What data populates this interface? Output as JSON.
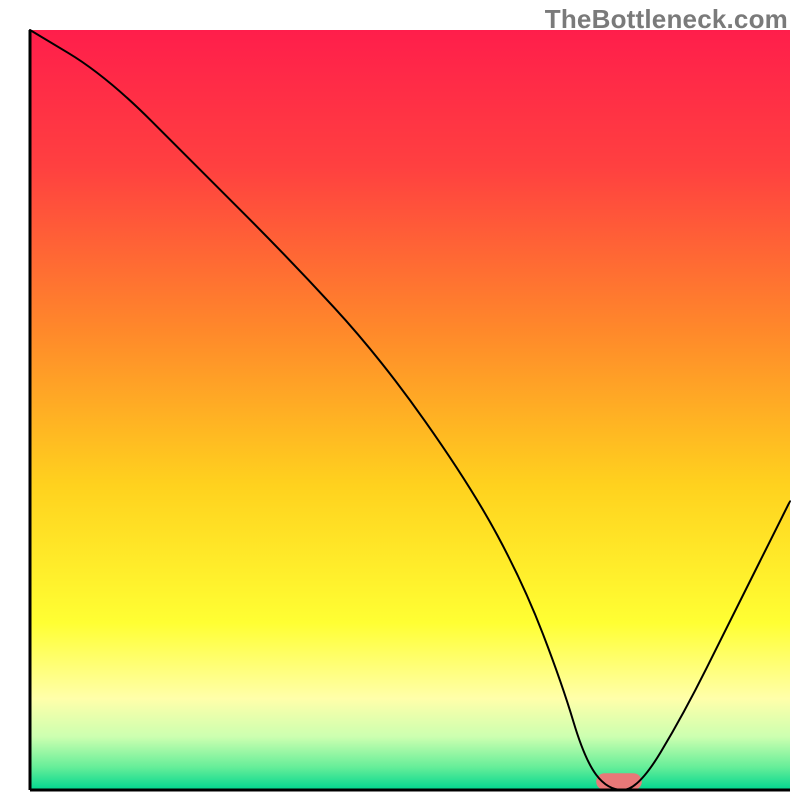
{
  "watermark": "TheBottleneck.com",
  "chart_data": {
    "type": "line",
    "title": "",
    "xlabel": "",
    "ylabel": "",
    "xlim": [
      0,
      100
    ],
    "ylim": [
      0,
      100
    ],
    "axes": {
      "left_line": true,
      "bottom_line": true,
      "color": "#000000"
    },
    "background_gradient": {
      "direction": "vertical",
      "stops": [
        {
          "offset": 0.0,
          "color": "#ff1e4b"
        },
        {
          "offset": 0.18,
          "color": "#ff4040"
        },
        {
          "offset": 0.4,
          "color": "#ff8a2a"
        },
        {
          "offset": 0.6,
          "color": "#ffd21e"
        },
        {
          "offset": 0.78,
          "color": "#ffff33"
        },
        {
          "offset": 0.88,
          "color": "#ffffaa"
        },
        {
          "offset": 0.93,
          "color": "#ccffb0"
        },
        {
          "offset": 0.97,
          "color": "#66ee99"
        },
        {
          "offset": 1.0,
          "color": "#00d68f"
        }
      ]
    },
    "series": [
      {
        "name": "bottleneck-curve",
        "color": "#000000",
        "stroke_width": 2,
        "x": [
          0,
          10,
          22,
          34,
          46,
          58,
          65,
          70,
          73,
          76,
          80,
          86,
          92,
          100
        ],
        "y": [
          100,
          94,
          82,
          70,
          57,
          40,
          27,
          14,
          4,
          0,
          0,
          10,
          22,
          38
        ]
      }
    ],
    "marker": {
      "name": "recommended-zone",
      "shape": "pill",
      "color": "#e87878",
      "x_center": 77.5,
      "y": 0,
      "width": 6,
      "height": 2.2
    }
  }
}
